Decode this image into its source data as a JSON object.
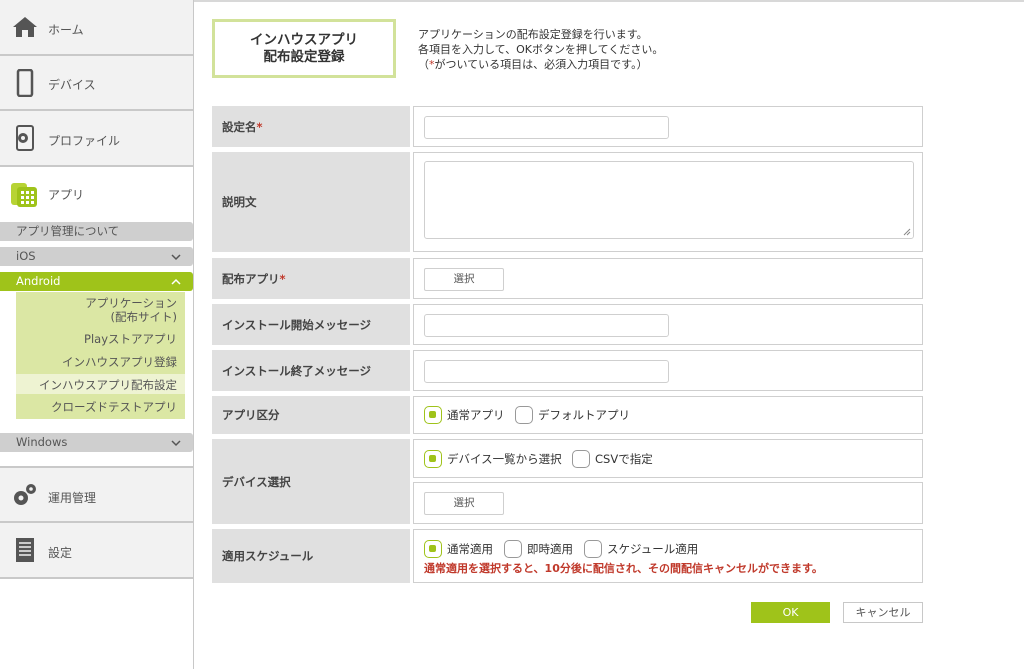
{
  "sidebar": {
    "home_label": "ホーム",
    "device_label": "デバイス",
    "profile_label": "プロファイル",
    "app_label": "アプリ",
    "about_label": "アプリ管理について",
    "ios_label": "iOS",
    "android_label": "Android",
    "android_items": [
      "アプリケーション\n(配布サイト)",
      "Playストアアプリ",
      "インハウスアプリ登録",
      "インハウスアプリ配布設定",
      "クローズドテストアプリ"
    ],
    "windows_label": "Windows",
    "ops_label": "運用管理",
    "settings_label": "設定"
  },
  "header": {
    "title_line1": "インハウスアプリ",
    "title_line2": "配布設定登録",
    "desc_line1": "アプリケーションの配布設定登録を行います。",
    "desc_line2": "各項目を入力して、OKボタンを押してください。",
    "desc_line3_pre": "（",
    "desc_line3_star": "*",
    "desc_line3_post": "がついている項目は、必須入力項目です。）"
  },
  "form": {
    "required_mark": "*",
    "setting_name_label": "設定名",
    "setting_name_value": "",
    "description_label": "説明文",
    "description_value": "",
    "dist_app_label": "配布アプリ",
    "select_button": "選択",
    "install_start_label": "インストール開始メッセージ",
    "install_start_value": "",
    "install_end_label": "インストール終了メッセージ",
    "install_end_value": "",
    "app_type_label": "アプリ区分",
    "app_type_normal": "通常アプリ",
    "app_type_default": "デフォルトアプリ",
    "device_select_label": "デバイス選択",
    "device_from_list": "デバイス一覧から選択",
    "device_csv": "CSVで指定",
    "schedule_label": "適用スケジュール",
    "schedule_normal": "通常適用",
    "schedule_immediate": "即時適用",
    "schedule_scheduled": "スケジュール適用",
    "schedule_warning": "通常適用を選択すると、10分後に配信され、その間配信キャンセルができます。"
  },
  "actions": {
    "ok_label": "OK",
    "cancel_label": "キャンセル"
  },
  "colors": {
    "accent": "#9fc31a",
    "required": "#c0392b"
  }
}
